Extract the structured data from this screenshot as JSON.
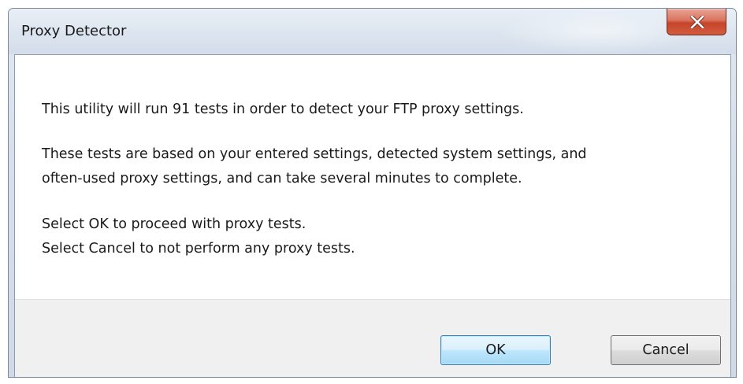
{
  "window": {
    "title": "Proxy Detector",
    "close_label": "X"
  },
  "message": {
    "line1": "This utility will run 91 tests in order to detect your FTP proxy settings.",
    "line2": "These tests are based on your entered settings, detected system settings, and",
    "line3": "often-used proxy settings, and can take several minutes to complete.",
    "line4": "Select OK to proceed with proxy tests.",
    "line5": "Select Cancel to not perform any proxy tests."
  },
  "buttons": {
    "ok_label": "OK",
    "cancel_label": "Cancel"
  },
  "colors": {
    "close_button": "#c6452b",
    "default_button_border": "#3c7fb1",
    "footer_background": "#f0f0f0"
  }
}
